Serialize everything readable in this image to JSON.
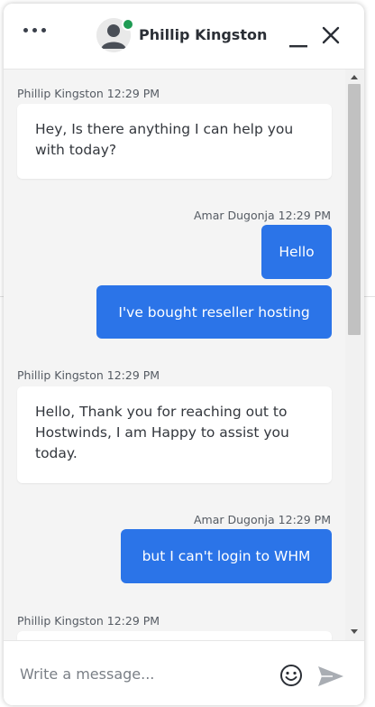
{
  "header": {
    "agent_name": "Phillip Kingston",
    "status": "online"
  },
  "messages": [
    {
      "sender": "Phillip Kingston",
      "time": "12:29 PM",
      "direction": "in",
      "lines": [
        "Hey, Is there anything I can help you",
        "with today?"
      ]
    },
    {
      "sender": "Amar Dugonja",
      "time": "12:29 PM",
      "direction": "out",
      "bubbles": [
        "Hello",
        "I've bought reseller hosting"
      ]
    },
    {
      "sender": "Phillip Kingston",
      "time": "12:29 PM",
      "direction": "in",
      "lines": [
        "Hello, Thank you for reaching out to",
        "Hostwinds, I am Happy to assist you",
        "today."
      ]
    },
    {
      "sender": "Amar Dugonja",
      "time": "12:29 PM",
      "direction": "out",
      "bubbles": [
        "but I can't login to WHM"
      ]
    },
    {
      "sender": "Phillip Kingston",
      "time": "12:29 PM",
      "direction": "in",
      "lines": []
    }
  ],
  "composer": {
    "placeholder": "Write a message..."
  },
  "colors": {
    "accent": "#2b74e8",
    "online": "#1e9b53",
    "background": "#f4f4f4"
  },
  "icons": [
    "more-icon",
    "avatar-icon",
    "minimize-icon",
    "close-icon",
    "emoji-icon",
    "send-icon"
  ]
}
